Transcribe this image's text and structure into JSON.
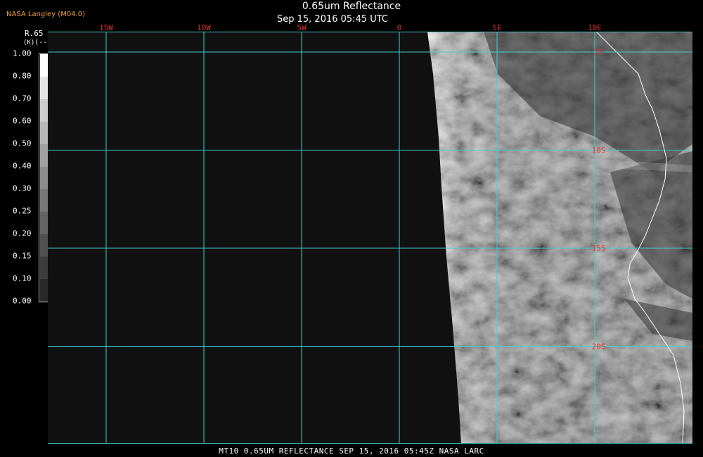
{
  "header": {
    "brand": "NASA Langley (M04.0)",
    "title": "0.65um Reflectance",
    "subtitle": "Sep 15, 2016 05:45 UTC"
  },
  "colorbar": {
    "title": "R.65",
    "unit": "(--)",
    "unit_small": "(K)",
    "ticks": [
      "1.00",
      "0.80",
      "0.70",
      "0.60",
      "0.50",
      "0.40",
      "0.30",
      "0.25",
      "0.20",
      "0.15",
      "0.10",
      "0.00"
    ],
    "shades": [
      "#ffffff",
      "#e4e4e4",
      "#cccccc",
      "#b6b6b6",
      "#a0a0a0",
      "#8c8c8c",
      "#787878",
      "#646464",
      "#505050",
      "#3c3c3c",
      "#282828"
    ]
  },
  "map": {
    "longitude_labels": [
      "15W",
      "10W",
      "5W",
      "0",
      "5E",
      "10E"
    ],
    "longitudes": [
      -15,
      -10,
      -5,
      0,
      5,
      10
    ],
    "latitude_labels": [
      "5S",
      "10S",
      "15S",
      "20S"
    ],
    "latitudes": [
      -5,
      -10,
      -15,
      -20
    ],
    "grid_color": "#40d0d0",
    "coast_color": "#ffffff",
    "background_color": "#111111"
  },
  "footer": {
    "caption": "MT10  0.65UM REFLECTANCE   SEP 15, 2016 05:45Z   NASA LARC"
  }
}
